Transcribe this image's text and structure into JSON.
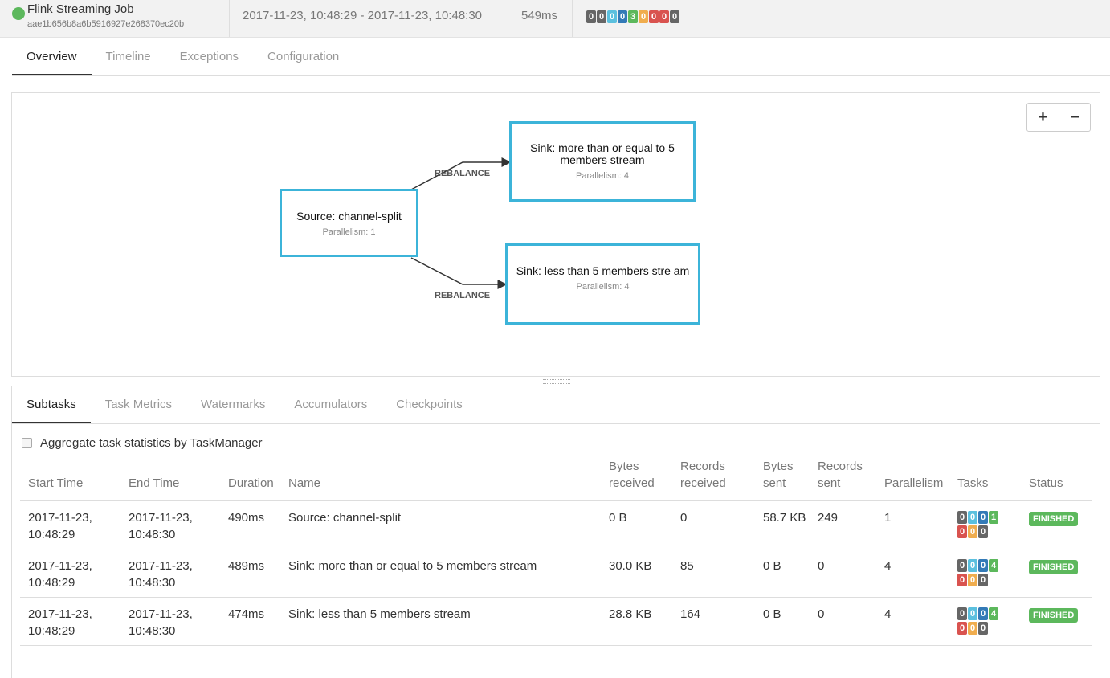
{
  "header": {
    "job_name": "Flink Streaming Job",
    "job_id": "aae1b656b8a6b5916927e268370ec20b",
    "time_range": "2017-11-23, 10:48:29 - 2017-11-23, 10:48:30",
    "duration": "549ms",
    "state_counts": [
      {
        "value": "0",
        "color": "#666666"
      },
      {
        "value": "0",
        "color": "#666666"
      },
      {
        "value": "0",
        "color": "#5bc0de"
      },
      {
        "value": "0",
        "color": "#337ab7"
      },
      {
        "value": "3",
        "color": "#5cb85c"
      },
      {
        "value": "0",
        "color": "#f0ad4e"
      },
      {
        "value": "0",
        "color": "#d9534f"
      },
      {
        "value": "0",
        "color": "#d9534f"
      },
      {
        "value": "0",
        "color": "#666666"
      }
    ]
  },
  "main_tabs": [
    "Overview",
    "Timeline",
    "Exceptions",
    "Configuration"
  ],
  "graph": {
    "zoom_in": "+",
    "zoom_out": "−",
    "nodes": [
      {
        "title": "Source: channel-split",
        "parallelism": "Parallelism: 1"
      },
      {
        "title": "Sink: more than or equal to 5 members stream",
        "parallelism": "Parallelism: 4"
      },
      {
        "title": "Sink: less than 5 members stre am",
        "parallelism": "Parallelism: 4"
      }
    ],
    "edges": [
      {
        "label": "REBALANCE"
      },
      {
        "label": "REBALANCE"
      }
    ]
  },
  "sub_tabs": [
    "Subtasks",
    "Task Metrics",
    "Watermarks",
    "Accumulators",
    "Checkpoints"
  ],
  "aggregate_label": "Aggregate task statistics by TaskManager",
  "table": {
    "columns": [
      "Start Time",
      "End Time",
      "Duration",
      "Name",
      "Bytes received",
      "Records received",
      "Bytes sent",
      "Records sent",
      "Parallelism",
      "Tasks",
      "Status"
    ],
    "rows": [
      {
        "start": "2017-11-23, 10:48:29",
        "end": "2017-11-23, 10:48:30",
        "duration": "490ms",
        "name": "Source: channel-split",
        "bytes_received": "0 B",
        "records_received": "0",
        "bytes_sent": "58.7 KB",
        "records_sent": "249",
        "parallelism": "1",
        "tasks": [
          "0",
          "0",
          "0",
          "1",
          "0",
          "0",
          "0"
        ],
        "status": "FINISHED"
      },
      {
        "start": "2017-11-23, 10:48:29",
        "end": "2017-11-23, 10:48:30",
        "duration": "489ms",
        "name": "Sink: more than or equal to 5 members stream",
        "bytes_received": "30.0 KB",
        "records_received": "85",
        "bytes_sent": "0 B",
        "records_sent": "0",
        "parallelism": "4",
        "tasks": [
          "0",
          "0",
          "0",
          "4",
          "0",
          "0",
          "0"
        ],
        "status": "FINISHED"
      },
      {
        "start": "2017-11-23, 10:48:29",
        "end": "2017-11-23, 10:48:30",
        "duration": "474ms",
        "name": "Sink: less than 5 members stream",
        "bytes_received": "28.8 KB",
        "records_received": "164",
        "bytes_sent": "0 B",
        "records_sent": "0",
        "parallelism": "4",
        "tasks": [
          "0",
          "0",
          "0",
          "4",
          "0",
          "0",
          "0"
        ],
        "status": "FINISHED"
      }
    ],
    "task_badge_colors": [
      "#666666",
      "#5bc0de",
      "#337ab7",
      "#5cb85c",
      "#d9534f",
      "#f0ad4e",
      "#666666"
    ]
  }
}
